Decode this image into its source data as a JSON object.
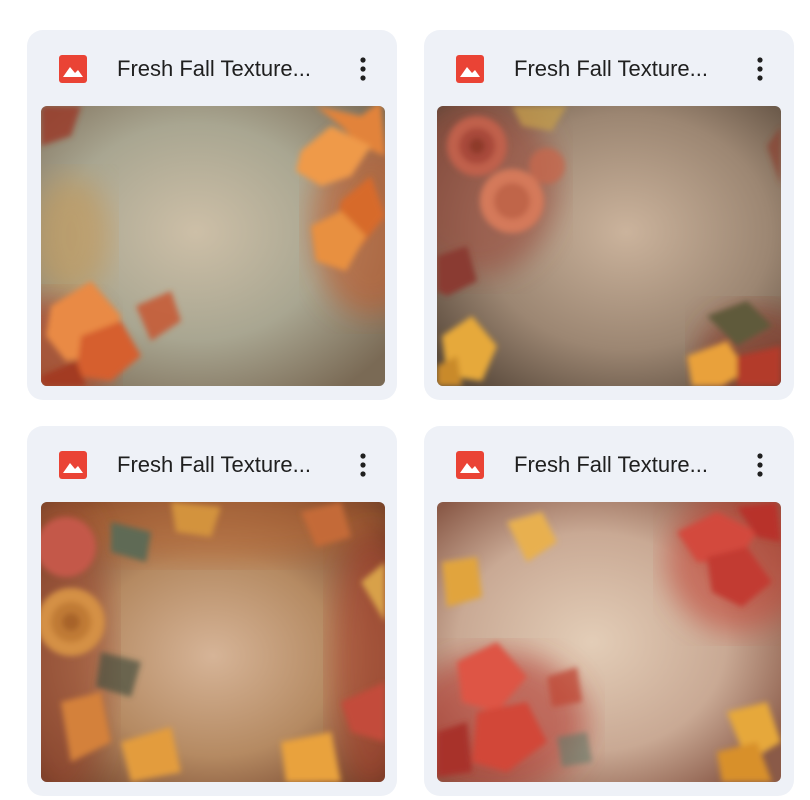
{
  "files": [
    {
      "title": "Fresh Fall Texture...",
      "icon": "image-file-icon",
      "accent": "#ea4335",
      "thumbnail": "autumn-leaves-texture"
    },
    {
      "title": "Fresh Fall Texture...",
      "icon": "image-file-icon",
      "accent": "#ea4335",
      "thumbnail": "roses-and-leaves-texture"
    },
    {
      "title": "Fresh Fall Texture...",
      "icon": "image-file-icon",
      "accent": "#ea4335",
      "thumbnail": "rose-border-texture"
    },
    {
      "title": "Fresh Fall Texture...",
      "icon": "image-file-icon",
      "accent": "#ea4335",
      "thumbnail": "red-flowers-texture"
    }
  ],
  "menu_icon": "more-vert-icon"
}
